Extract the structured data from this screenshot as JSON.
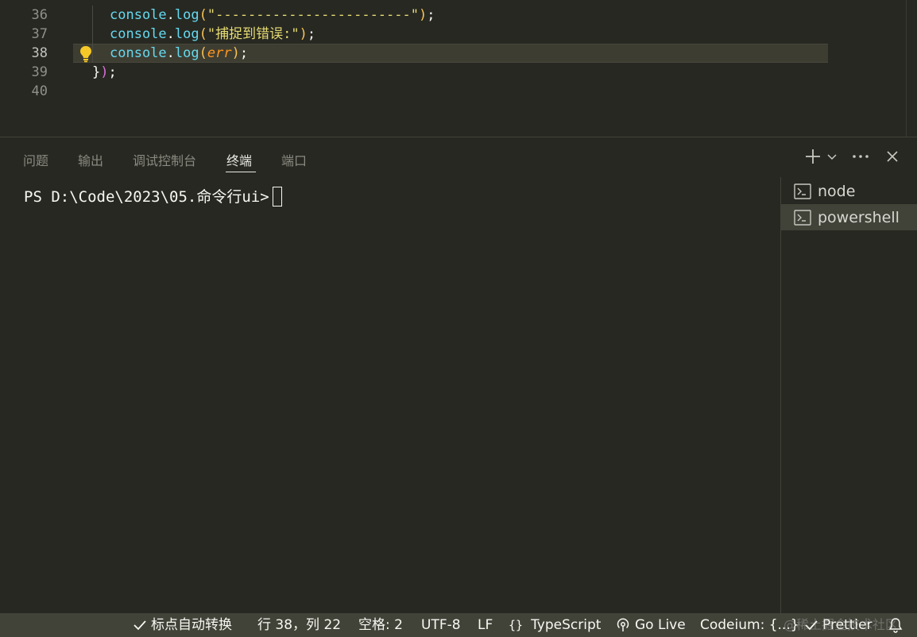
{
  "editor": {
    "lines": [
      {
        "number": "36",
        "parts": [
          [
            "t-fn",
            "console"
          ],
          [
            "t-punc",
            "."
          ],
          [
            "t-fn",
            "log"
          ],
          [
            "t-paren",
            "("
          ],
          [
            "t-str",
            "\"------------------------\""
          ],
          [
            "t-paren",
            ")"
          ],
          [
            "t-punc",
            ";"
          ]
        ]
      },
      {
        "number": "37",
        "parts": [
          [
            "t-fn",
            "console"
          ],
          [
            "t-punc",
            "."
          ],
          [
            "t-fn",
            "log"
          ],
          [
            "t-paren",
            "("
          ],
          [
            "t-str",
            "\"捕捉到错误:\""
          ],
          [
            "t-paren",
            ")"
          ],
          [
            "t-punc",
            ";"
          ]
        ]
      },
      {
        "number": "38",
        "parts": [
          [
            "t-fn",
            "console"
          ],
          [
            "t-punc",
            "."
          ],
          [
            "t-fn",
            "log"
          ],
          [
            "t-paren",
            "("
          ],
          [
            "t-err",
            "err"
          ],
          [
            "t-paren",
            ")"
          ],
          [
            "t-punc",
            ";"
          ]
        ]
      },
      {
        "number": "39",
        "parts": [
          [
            "t-brace",
            "}"
          ],
          [
            "t-par2",
            ")"
          ],
          [
            "t-punc",
            ";"
          ]
        ]
      },
      {
        "number": "40",
        "parts": []
      }
    ],
    "active_line": "38"
  },
  "panel": {
    "tabs": [
      {
        "label": "问题",
        "active": false
      },
      {
        "label": "输出",
        "active": false
      },
      {
        "label": "调试控制台",
        "active": false
      },
      {
        "label": "终端",
        "active": true
      },
      {
        "label": "端口",
        "active": false
      }
    ],
    "actions": {
      "new_terminal_icon": "plus-icon",
      "dropdown_icon": "chevron-down-icon",
      "more_icon": "ellipsis-icon",
      "close_icon": "close-icon"
    }
  },
  "terminal": {
    "prompt": "PS D:\\Code\\2023\\05.命令行ui>",
    "instances": [
      {
        "label": "node",
        "selected": false
      },
      {
        "label": "powershell",
        "selected": true
      }
    ]
  },
  "statusbar": {
    "format_toggle": "标点自动转换",
    "position": "行 38，列 22",
    "spaces": "空格: 2",
    "encoding": "UTF-8",
    "eol": "LF",
    "language": "TypeScript",
    "go_live": "Go Live",
    "codeium": "Codeium: {...}",
    "prettier": "Prettier"
  },
  "watermark": "@稀土掘金技术社区",
  "colors": {
    "background": "#272822",
    "statusbar": "#414339",
    "string": "#e6db74",
    "function": "#66d9ef",
    "parameter": "#fd971f",
    "lightbulb": "#f6c928"
  }
}
